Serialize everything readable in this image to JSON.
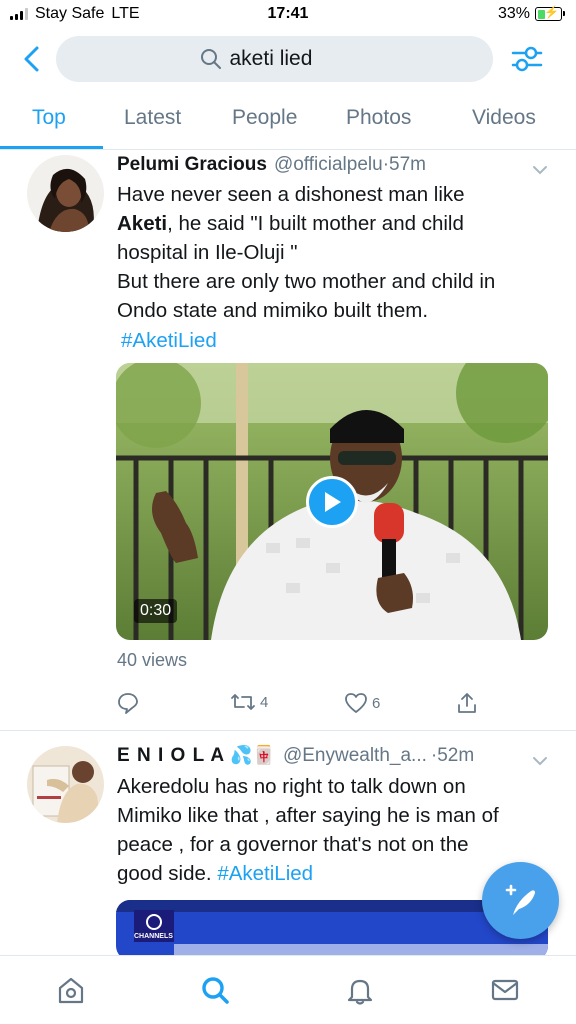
{
  "status_bar": {
    "carrier": "Stay Safe",
    "network": "LTE",
    "time": "17:41",
    "battery_percent": "33%",
    "battery_level": 0.33
  },
  "search": {
    "query": "aketi lied"
  },
  "tabs": [
    {
      "label": "Top",
      "active": true
    },
    {
      "label": "Latest",
      "active": false
    },
    {
      "label": "People",
      "active": false
    },
    {
      "label": "Photos",
      "active": false
    },
    {
      "label": "Videos",
      "active": false
    }
  ],
  "tweets": [
    {
      "name": "Pelumi Gracious",
      "handle": "@officialpelu",
      "separator": "·",
      "time": "57m",
      "text_1": "Have never seen a dishonest man like",
      "text_bold": "Aketi",
      "text_2": ", he said \"I built mother and child",
      "text_3": "hospital in Ile-Oluji \"",
      "text_4": "But there are only two mother and child in",
      "text_5": "Ondo state and mimiko built them.",
      "hashtag": "#AketiLied",
      "video_duration": "0:30",
      "views": "40 views",
      "retweets": "4",
      "likes": "6"
    },
    {
      "name": "E N I O L A",
      "emoji": "💦🀄",
      "handle": "@Enywealth_a...",
      "separator": "·",
      "time": "52m",
      "text_1": "Akeredolu has no right to talk down on",
      "text_2": "Mimiko like that , after saying he is man of",
      "text_3": "peace , for a governor that's not on the",
      "text_4": "good side.",
      "hashtag": "#AketiLied",
      "media_caption": "CHANNELS"
    }
  ],
  "icons": {
    "back": "chevron-left-icon",
    "search": "search-icon",
    "filter": "filter-icon",
    "reply": "reply-icon",
    "retweet": "retweet-icon",
    "like": "heart-icon",
    "share": "share-icon",
    "compose": "compose-icon",
    "home": "home-icon",
    "explore": "search-icon",
    "notifications": "bell-icon",
    "messages": "mail-icon"
  },
  "colors": {
    "accent": "#1da1f2",
    "secondary_text": "#657786",
    "search_bg": "#e6ecf0"
  }
}
